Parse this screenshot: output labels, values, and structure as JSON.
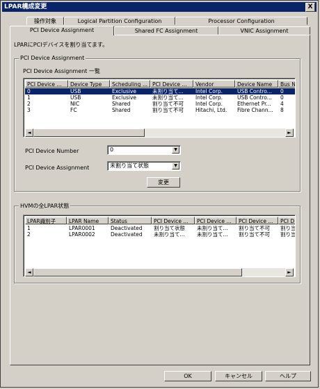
{
  "window": {
    "title": "LPAR構成変更",
    "close_label": "X"
  },
  "tabs_row1": [
    "操作対象",
    "Logical Partition Configuration",
    "Processor Configuration"
  ],
  "tabs_row2": [
    "PCI Device Assignment",
    "Shared FC Assignment",
    "VNIC Assignment"
  ],
  "active_tab": "PCI Device Assignment",
  "instruction": "LPARにPCIデバイスを割り当てます。",
  "pci_group": {
    "legend": "PCI Device Assignment",
    "list_title": "PCI Device Assignment 一覧",
    "columns": [
      "PCI Device ...",
      "Device Type",
      "Scheduling ...",
      "PCI Device ...",
      "Vendor",
      "Device Name",
      "Bus N"
    ],
    "rows": [
      [
        "0",
        "USB",
        "Exclusive",
        "未割り当て...",
        "Intel Corp.",
        "USB Contro...",
        "0"
      ],
      [
        "1",
        "USB",
        "Exclusive",
        "未割り当て...",
        "Intel Corp.",
        "USB Contro...",
        "0"
      ],
      [
        "2",
        "NIC",
        "Shared",
        "割り当て不可",
        "Intel Corp.",
        "Ethernet Pr...",
        "4"
      ],
      [
        "3",
        "FC",
        "Shared",
        "割り当て不可",
        "Hitachi, Ltd.",
        "Fibre Chann...",
        "8"
      ]
    ],
    "selected_row": 0,
    "device_number_label": "PCI Device Number",
    "device_number_value": "0",
    "assignment_label": "PCI Device Assignment",
    "assignment_value": "未割り当て状態",
    "change_button": "変更"
  },
  "lpar_group": {
    "legend": "HVMの全LPAR状態",
    "columns": [
      "LPAR識別子",
      "LPAR Name",
      "Status",
      "PCI Device ...",
      "PCI Device ...",
      "PCI Device ...",
      "PCI D"
    ],
    "rows": [
      [
        "1",
        "LPAR0001",
        "Deactivated",
        "割り当て状態",
        "未割り当て...",
        "割り当て不可",
        "割り当"
      ],
      [
        "2",
        "LPAR0002",
        "Deactivated",
        "未割り当て...",
        "未割り当て...",
        "割り当て不可",
        "割り当"
      ]
    ]
  },
  "buttons": {
    "ok": "OK",
    "cancel": "キャンセル",
    "help": "ヘルプ"
  },
  "colors": {
    "selection": "#0a246a",
    "face": "#d4d0c8",
    "title_bar": "#0a246a"
  },
  "icons": {
    "scroll_left": "◄",
    "scroll_right": "►",
    "dropdown": "▼"
  }
}
